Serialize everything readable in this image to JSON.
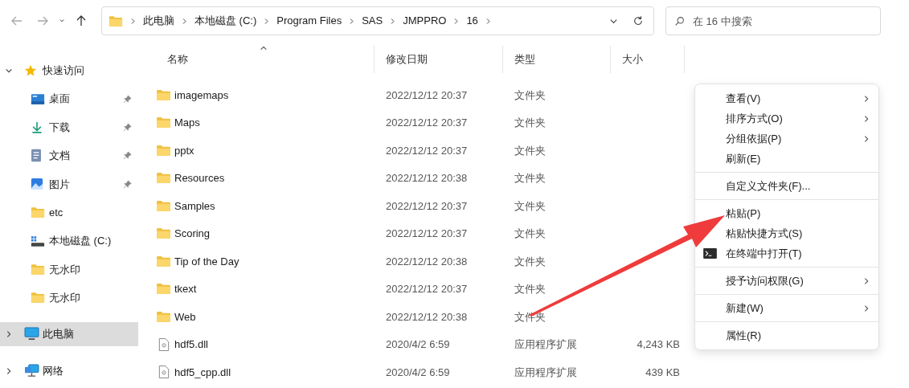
{
  "navigation": [
    {
      "kind": "back",
      "disabled": true
    },
    {
      "kind": "forward",
      "disabled": true
    },
    {
      "kind": "recent",
      "disabled": false
    },
    {
      "kind": "up",
      "disabled": false
    }
  ],
  "address_bar": {
    "path": [
      "此电脑",
      "本地磁盘 (C:)",
      "Program Files",
      "SAS",
      "JMPPRO",
      "16"
    ]
  },
  "search": {
    "placeholder": "在 16 中搜索"
  },
  "sidebar": {
    "items": [
      {
        "label": "快速访问",
        "kind": "star",
        "expanded": true,
        "pinned": false,
        "selected": false
      },
      {
        "label": "桌面",
        "kind": "desktop",
        "pinned": true,
        "selected": false
      },
      {
        "label": "下载",
        "kind": "download",
        "pinned": true,
        "selected": false
      },
      {
        "label": "文档",
        "kind": "documents",
        "pinned": true,
        "selected": false
      },
      {
        "label": "图片",
        "kind": "pictures",
        "pinned": true,
        "selected": false
      },
      {
        "label": "etc",
        "kind": "folder",
        "pinned": false,
        "selected": false
      },
      {
        "label": "本地磁盘 (C:)",
        "kind": "drive",
        "pinned": false,
        "selected": false
      },
      {
        "label": "无水印",
        "kind": "folder",
        "pinned": false,
        "selected": false
      },
      {
        "label": "无水印",
        "kind": "folder",
        "pinned": false,
        "selected": false
      },
      {
        "label": "此电脑",
        "kind": "pc",
        "expanded": false,
        "pinned": false,
        "selected": true
      },
      {
        "label": "网络",
        "kind": "network",
        "expanded": false,
        "pinned": false,
        "selected": false
      }
    ]
  },
  "table": {
    "columns": [
      {
        "label": "名称",
        "sorted": true
      },
      {
        "label": "修改日期",
        "sorted": false
      },
      {
        "label": "类型",
        "sorted": false
      },
      {
        "label": "大小",
        "sorted": false
      }
    ],
    "rows": [
      {
        "kind": "folder",
        "name": "imagemaps",
        "modified": "2022/12/12 20:37",
        "type": "文件夹"
      },
      {
        "kind": "folder",
        "name": "Maps",
        "modified": "2022/12/12 20:37",
        "type": "文件夹"
      },
      {
        "kind": "folder",
        "name": "pptx",
        "modified": "2022/12/12 20:37",
        "type": "文件夹"
      },
      {
        "kind": "folder",
        "name": "Resources",
        "modified": "2022/12/12 20:38",
        "type": "文件夹"
      },
      {
        "kind": "folder",
        "name": "Samples",
        "modified": "2022/12/12 20:37",
        "type": "文件夹"
      },
      {
        "kind": "folder",
        "name": "Scoring",
        "modified": "2022/12/12 20:37",
        "type": "文件夹"
      },
      {
        "kind": "folder",
        "name": "Tip of the Day",
        "modified": "2022/12/12 20:38",
        "type": "文件夹"
      },
      {
        "kind": "folder",
        "name": "tkext",
        "modified": "2022/12/12 20:37",
        "type": "文件夹"
      },
      {
        "kind": "folder",
        "name": "Web",
        "modified": "2022/12/12 20:38",
        "type": "文件夹"
      },
      {
        "kind": "file",
        "name": "hdf5.dll",
        "modified": "2020/4/2 6:59",
        "type": "应用程序扩展",
        "size": "4,243 KB"
      },
      {
        "kind": "file",
        "name": "hdf5_cpp.dll",
        "modified": "2020/4/2 6:59",
        "type": "应用程序扩展",
        "size": "439 KB"
      }
    ]
  },
  "context_menu": {
    "items": [
      {
        "kind": "item",
        "label": "查看(V)",
        "submenu": true
      },
      {
        "kind": "item",
        "label": "排序方式(O)",
        "submenu": true
      },
      {
        "kind": "item",
        "label": "分组依据(P)",
        "submenu": true
      },
      {
        "kind": "item",
        "label": "刷新(E)",
        "submenu": false
      },
      {
        "kind": "separator"
      },
      {
        "kind": "item",
        "label": "自定义文件夹(F)...",
        "submenu": false
      },
      {
        "kind": "separator"
      },
      {
        "kind": "item",
        "label": "粘贴(P)",
        "submenu": false
      },
      {
        "kind": "item",
        "label": "粘贴快捷方式(S)",
        "submenu": false
      },
      {
        "kind": "terminal",
        "label": "在终端中打开(T)",
        "submenu": false
      },
      {
        "kind": "separator"
      },
      {
        "kind": "item",
        "label": "授予访问权限(G)",
        "submenu": true
      },
      {
        "kind": "separator"
      },
      {
        "kind": "item",
        "label": "新建(W)",
        "submenu": true
      },
      {
        "kind": "separator"
      },
      {
        "kind": "item",
        "label": "属性(R)",
        "submenu": false
      }
    ]
  },
  "annotation": {
    "kind": "arrow"
  }
}
